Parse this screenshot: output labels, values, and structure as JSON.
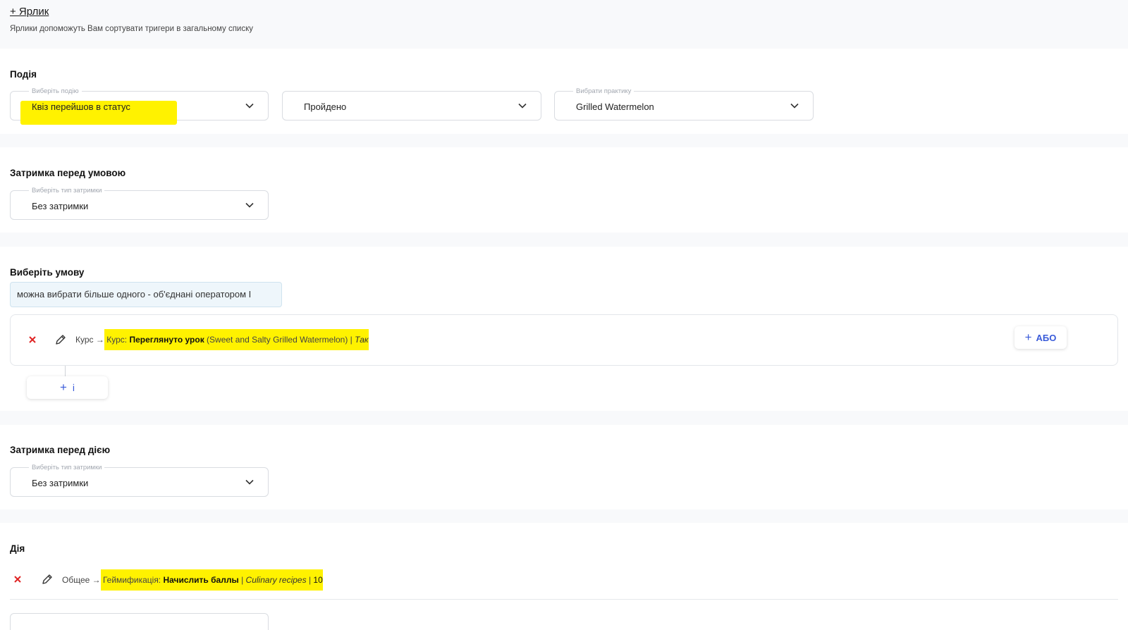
{
  "labels": {
    "add_label": "+ Ярлик",
    "hint": "Ярлики допоможуть Вам сортувати тригери в загальному списку"
  },
  "event": {
    "title": "Подія",
    "select_event": {
      "legend": "Виберіть подію",
      "value": "Квіз перейшов в статус"
    },
    "status": {
      "value": "Пройдено"
    },
    "practice": {
      "legend": "Вибрати практику",
      "value": "Grilled Watermelon"
    }
  },
  "delay_condition": {
    "title": "Затримка перед умовою",
    "legend": "Виберіть тип затримки",
    "value": "Без затримки"
  },
  "condition": {
    "title": "Виберіть умову",
    "note": "можна вибрати більше одного - об'єднані оператором І",
    "item": {
      "prefix": "Курс →",
      "category": "Курс:",
      "action": "Переглянуто урок",
      "detail": "(Sweet and Salty Grilled Watermelon) |",
      "tail": "Так"
    },
    "or_button": "АБО",
    "and_button": "і"
  },
  "delay_action": {
    "title": "Затримка перед дією",
    "legend": "Виберіть тип затримки",
    "value": "Без затримки"
  },
  "action": {
    "title": "Дія",
    "item": {
      "prefix": "Общее →",
      "category": "Геймификація:",
      "action": "Начислить баллы",
      "sep1": "|",
      "course": "Culinary recipes",
      "sep2": "|",
      "points": "10"
    }
  },
  "colors": {
    "accent": "#3a5bd9",
    "delete": "#e02424",
    "highlight": "#fff200"
  }
}
